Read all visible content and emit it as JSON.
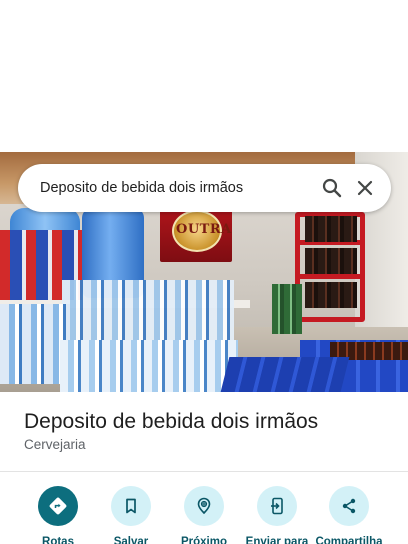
{
  "search": {
    "query": "Deposito de bebida dois irmãos"
  },
  "photo": {
    "poster_text": "OUTRA"
  },
  "place": {
    "name": "Deposito de bebida dois irmãos",
    "category": "Cervejaria"
  },
  "actions": [
    {
      "label": "Rotas",
      "icon": "directions-icon"
    },
    {
      "label": "Salvar",
      "icon": "bookmark-icon"
    },
    {
      "label": "Próximo",
      "icon": "nearby-icon"
    },
    {
      "label": "Enviar para",
      "icon": "send-to-phone-icon"
    },
    {
      "label": "Compartilha",
      "icon": "share-icon"
    }
  ],
  "colors": {
    "primary_action": "#0d6e7e",
    "action_tint": "#d3f1f7",
    "action_text": "#0b5766"
  }
}
